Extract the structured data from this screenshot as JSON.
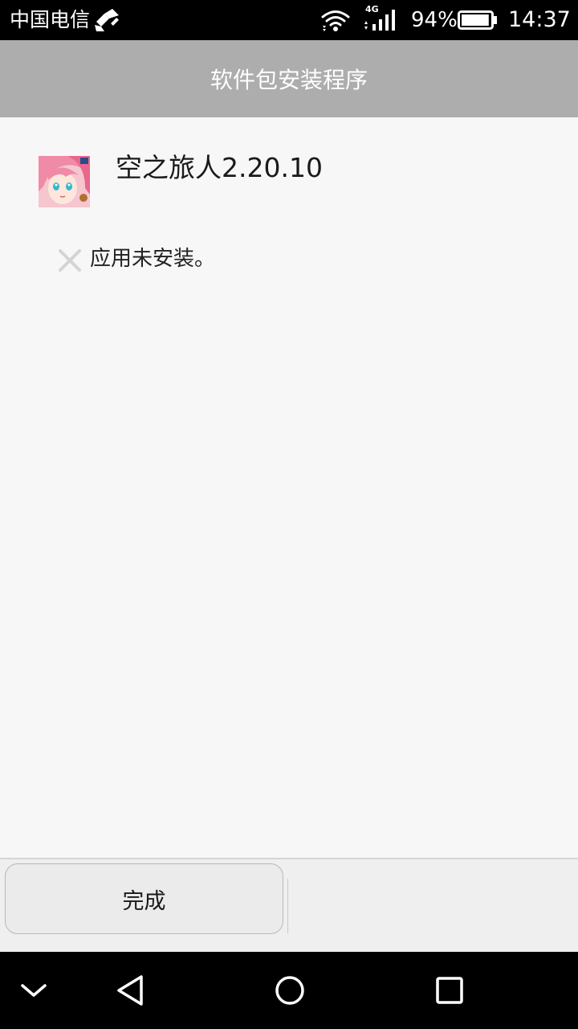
{
  "status_bar": {
    "carrier": "中国电信",
    "network_type": "4G",
    "battery_percent": "94%",
    "battery_level": 0.94,
    "time": "14:37",
    "icons": [
      "usb-debug-icon",
      "wifi-icon",
      "signal-icon",
      "battery-icon"
    ]
  },
  "header": {
    "title": "软件包安装程序"
  },
  "app": {
    "name": "空之旅人2.20.10",
    "icon": "app-icon"
  },
  "install_status": {
    "icon": "close-icon",
    "message": "应用未安装。"
  },
  "footer": {
    "done_label": "完成"
  },
  "nav_bar": {
    "icons": [
      "collapse-icon",
      "back-icon",
      "home-icon",
      "recents-icon"
    ]
  },
  "colors": {
    "title_bar": "#adadad",
    "content_bg": "#f7f7f7",
    "status_bar": "#000000"
  }
}
